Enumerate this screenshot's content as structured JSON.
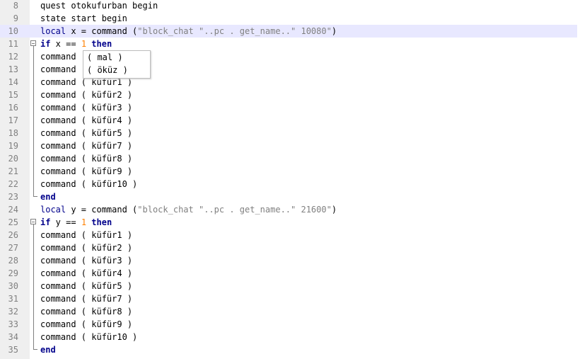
{
  "editor": {
    "lines": [
      {
        "number": "8",
        "tokens": [
          {
            "t": "quest otokufurban begin",
            "c": ""
          }
        ]
      },
      {
        "number": "9",
        "tokens": [
          {
            "t": "state start begin",
            "c": ""
          }
        ]
      },
      {
        "number": "10",
        "tokens": [
          {
            "t": "local",
            "c": "kw-plain"
          },
          {
            "t": " x = command (",
            "c": ""
          },
          {
            "t": "\"block_chat \"..pc . get_name..\" 10080\"",
            "c": "str"
          },
          {
            "t": ")",
            "c": ""
          }
        ]
      },
      {
        "number": "11",
        "tokens": [
          {
            "t": "if",
            "c": "kw"
          },
          {
            "t": " x == ",
            "c": ""
          },
          {
            "t": "1",
            "c": "num"
          },
          {
            "t": " ",
            "c": ""
          },
          {
            "t": "then",
            "c": "kw"
          }
        ]
      },
      {
        "number": "12",
        "tokens": [
          {
            "t": "command",
            "c": ""
          }
        ]
      },
      {
        "number": "13",
        "tokens": [
          {
            "t": "command",
            "c": ""
          }
        ]
      },
      {
        "number": "14",
        "tokens": [
          {
            "t": "command ( küfür1 )",
            "c": ""
          }
        ]
      },
      {
        "number": "15",
        "tokens": [
          {
            "t": "command ( küfür2 )",
            "c": ""
          }
        ]
      },
      {
        "number": "16",
        "tokens": [
          {
            "t": "command ( küfür3 )",
            "c": ""
          }
        ]
      },
      {
        "number": "17",
        "tokens": [
          {
            "t": "command ( küfür4 )",
            "c": ""
          }
        ]
      },
      {
        "number": "18",
        "tokens": [
          {
            "t": "command ( küfür5 )",
            "c": ""
          }
        ]
      },
      {
        "number": "19",
        "tokens": [
          {
            "t": "command ( küfür7 )",
            "c": ""
          }
        ]
      },
      {
        "number": "20",
        "tokens": [
          {
            "t": "command ( küfür8 )",
            "c": ""
          }
        ]
      },
      {
        "number": "21",
        "tokens": [
          {
            "t": "command ( küfür9 )",
            "c": ""
          }
        ]
      },
      {
        "number": "22",
        "tokens": [
          {
            "t": "command ( küfür10 )",
            "c": ""
          }
        ]
      },
      {
        "number": "23",
        "tokens": [
          {
            "t": "end",
            "c": "kw"
          }
        ]
      },
      {
        "number": "24",
        "tokens": [
          {
            "t": "local",
            "c": "kw-plain"
          },
          {
            "t": " y = command (",
            "c": ""
          },
          {
            "t": "\"block_chat \"..pc . get_name..\" 21600\"",
            "c": "str"
          },
          {
            "t": ")",
            "c": ""
          }
        ]
      },
      {
        "number": "25",
        "tokens": [
          {
            "t": "if",
            "c": "kw"
          },
          {
            "t": " y == ",
            "c": ""
          },
          {
            "t": "1",
            "c": "num"
          },
          {
            "t": " ",
            "c": ""
          },
          {
            "t": "then",
            "c": "kw"
          }
        ]
      },
      {
        "number": "26",
        "tokens": [
          {
            "t": "command ( küfür1 )",
            "c": ""
          }
        ]
      },
      {
        "number": "27",
        "tokens": [
          {
            "t": "command ( küfür2 )",
            "c": ""
          }
        ]
      },
      {
        "number": "28",
        "tokens": [
          {
            "t": "command ( küfür3 )",
            "c": ""
          }
        ]
      },
      {
        "number": "29",
        "tokens": [
          {
            "t": "command ( küfür4 )",
            "c": ""
          }
        ]
      },
      {
        "number": "30",
        "tokens": [
          {
            "t": "command ( küfür5 )",
            "c": ""
          }
        ]
      },
      {
        "number": "31",
        "tokens": [
          {
            "t": "command ( küfür7 )",
            "c": ""
          }
        ]
      },
      {
        "number": "32",
        "tokens": [
          {
            "t": "command ( küfür8 )",
            "c": ""
          }
        ]
      },
      {
        "number": "33",
        "tokens": [
          {
            "t": "command ( küfür9 )",
            "c": ""
          }
        ]
      },
      {
        "number": "34",
        "tokens": [
          {
            "t": "command ( küfür10 )",
            "c": ""
          }
        ]
      },
      {
        "number": "35",
        "tokens": [
          {
            "t": "end",
            "c": "kw"
          }
        ]
      }
    ],
    "current_line": "10",
    "fold_markers": [
      "11",
      "25"
    ],
    "fold_ends": [
      "23",
      "35"
    ]
  },
  "autocomplete": {
    "items": [
      "( mal )",
      "( öküz )"
    ]
  },
  "colors": {
    "keyword": "#00008b",
    "string": "#808080",
    "number": "#ff8000",
    "current_line_bg": "#e8e8ff",
    "gutter_bg": "#efefef"
  }
}
